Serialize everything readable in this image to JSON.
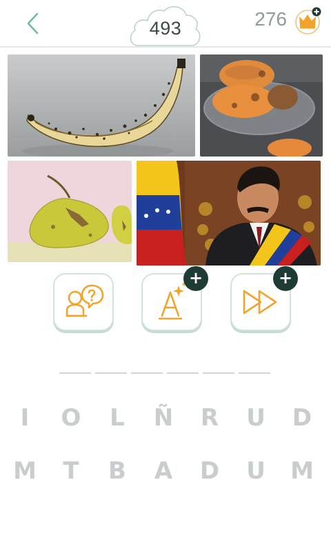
{
  "header": {
    "level": "493",
    "coins": "276"
  },
  "colors": {
    "accent_orange": "#f2a42a",
    "dark_teal": "#1f3b36",
    "header_teal": "#6fb8a8",
    "tile_gray": "#c9cdcd"
  },
  "photos": [
    {
      "subject": "overripe-banana"
    },
    {
      "subject": "overripe-mangoes-in-glass-bowl"
    },
    {
      "subject": "bruised-pears"
    },
    {
      "subject": "man-with-presidential-sash-and-flag"
    }
  ],
  "hints": [
    {
      "icon": "ask-friend-icon",
      "badge": ""
    },
    {
      "icon": "reveal-letter-icon",
      "badge": "+"
    },
    {
      "icon": "skip-level-icon",
      "badge": "+"
    }
  ],
  "answer_slot_count": 6,
  "letters_row1": [
    "I",
    "O",
    "L",
    "Ñ",
    "R",
    "U",
    "D"
  ],
  "letters_row2": [
    "M",
    "T",
    "B",
    "A",
    "D",
    "U",
    "M"
  ]
}
